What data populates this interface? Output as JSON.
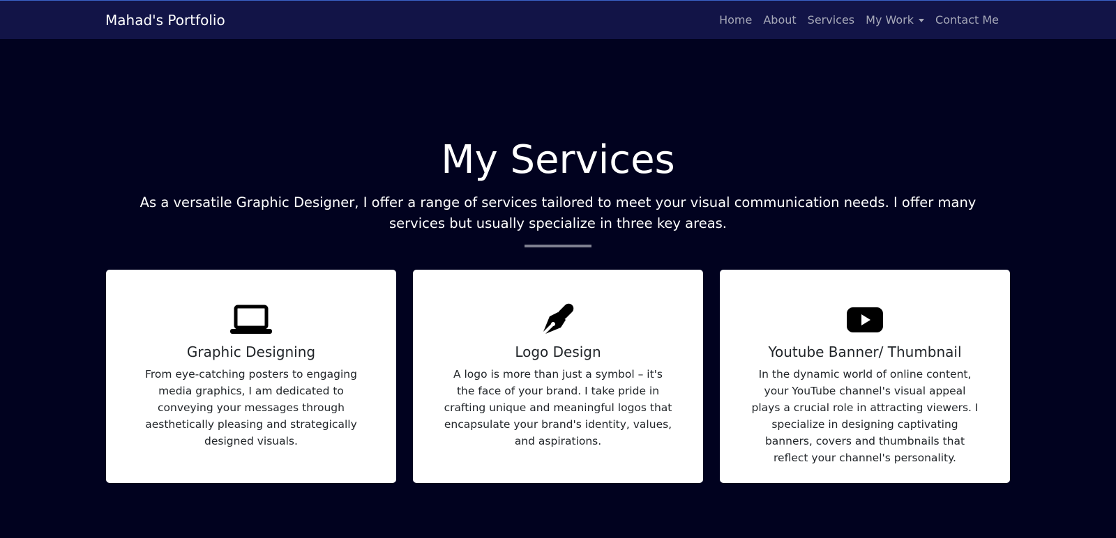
{
  "navbar": {
    "brand": "Mahad's Portfolio",
    "links": [
      "Home",
      "About",
      "Services",
      "My Work",
      "Contact Me"
    ]
  },
  "hero": {
    "title": "My Services",
    "lead": "As a versatile Graphic Designer, I offer a range of services tailored to meet your visual communication needs. I offer many services but usually specialize in three key areas."
  },
  "cards": [
    {
      "icon": "laptop-icon",
      "title": "Graphic Designing",
      "text": "From eye-catching posters to engaging media graphics, I am dedicated to conveying your messages through aesthetically pleasing and strategically designed visuals."
    },
    {
      "icon": "pen-nib-icon",
      "title": "Logo Design",
      "text": "A logo is more than just a symbol – it's the face of your brand. I take pride in crafting unique and meaningful logos that encapsulate your brand's identity, values, and aspirations."
    },
    {
      "icon": "youtube-icon",
      "title": "Youtube Banner/ Thumbnail",
      "text": "In the dynamic world of online content, your YouTube channel's visual appeal plays a crucial role in attracting viewers. I specialize in designing captivating banners, covers and thumbnails that reflect your channel's personality."
    }
  ],
  "colors": {
    "page_bg": "#01021f",
    "navbar_bg": "#121447",
    "nav_link": "#a6a8b8",
    "card_bg": "#ffffff"
  }
}
